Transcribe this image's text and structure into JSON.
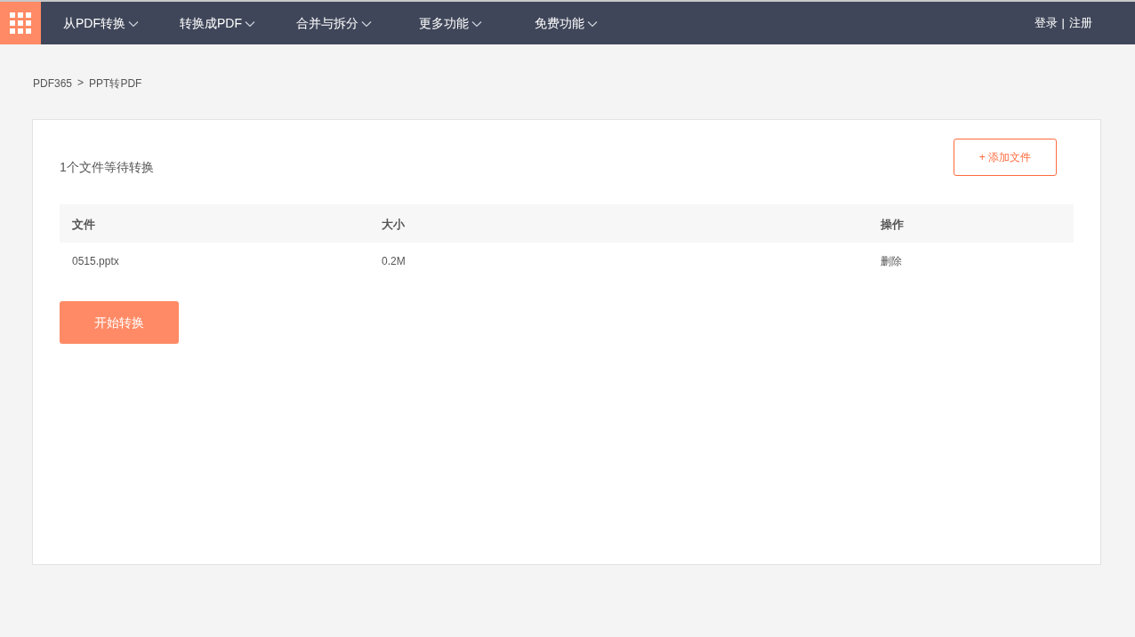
{
  "nav": {
    "items": [
      {
        "label": "从PDF转换",
        "has_dropdown": true
      },
      {
        "label": "转换成PDF",
        "has_dropdown": true
      },
      {
        "label": "合并与拆分",
        "has_dropdown": true
      },
      {
        "label": "更多功能",
        "has_dropdown": true
      },
      {
        "label": "免费功能",
        "has_dropdown": true
      }
    ],
    "login": "登录",
    "divider": "|",
    "register": "注册"
  },
  "breadcrumb": {
    "items": [
      "PDF365",
      "PPT转PDF"
    ],
    "separator": ">"
  },
  "panel": {
    "status": "1个文件等待转换",
    "add_button": "+ 添加文件",
    "table": {
      "columns": [
        "文件",
        "大小",
        "操作"
      ],
      "rows": [
        {
          "name": "0515.pptx",
          "size": "0.2M",
          "action": "删除"
        }
      ]
    },
    "start_button": "开始转换"
  }
}
